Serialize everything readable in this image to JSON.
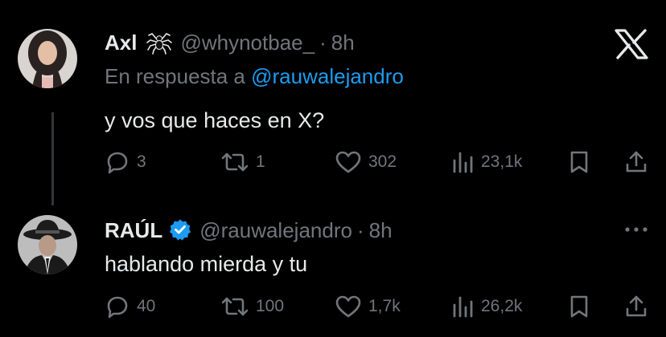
{
  "app": {
    "logo_icon": "x-logo-icon"
  },
  "thread": [
    {
      "name": "Axl",
      "handle": "@whynotbae_",
      "time": "8h",
      "reply_prefix": "En respuesta a",
      "reply_mention": "@rauwalejandro",
      "text": "y vos que haces en X?",
      "replies": "3",
      "reposts": "1",
      "likes": "302",
      "views": "23,1k"
    },
    {
      "name": "RAÚL",
      "verified": true,
      "handle": "@rauwalejandro",
      "time": "8h",
      "text": "hablando mierda y tu",
      "replies": "40",
      "reposts": "100",
      "likes": "1,7k",
      "views": "26,2k"
    }
  ],
  "colors": {
    "background": "#000000",
    "text": "#e7e9ea",
    "muted": "#71767b",
    "accent": "#1d9bf0"
  }
}
